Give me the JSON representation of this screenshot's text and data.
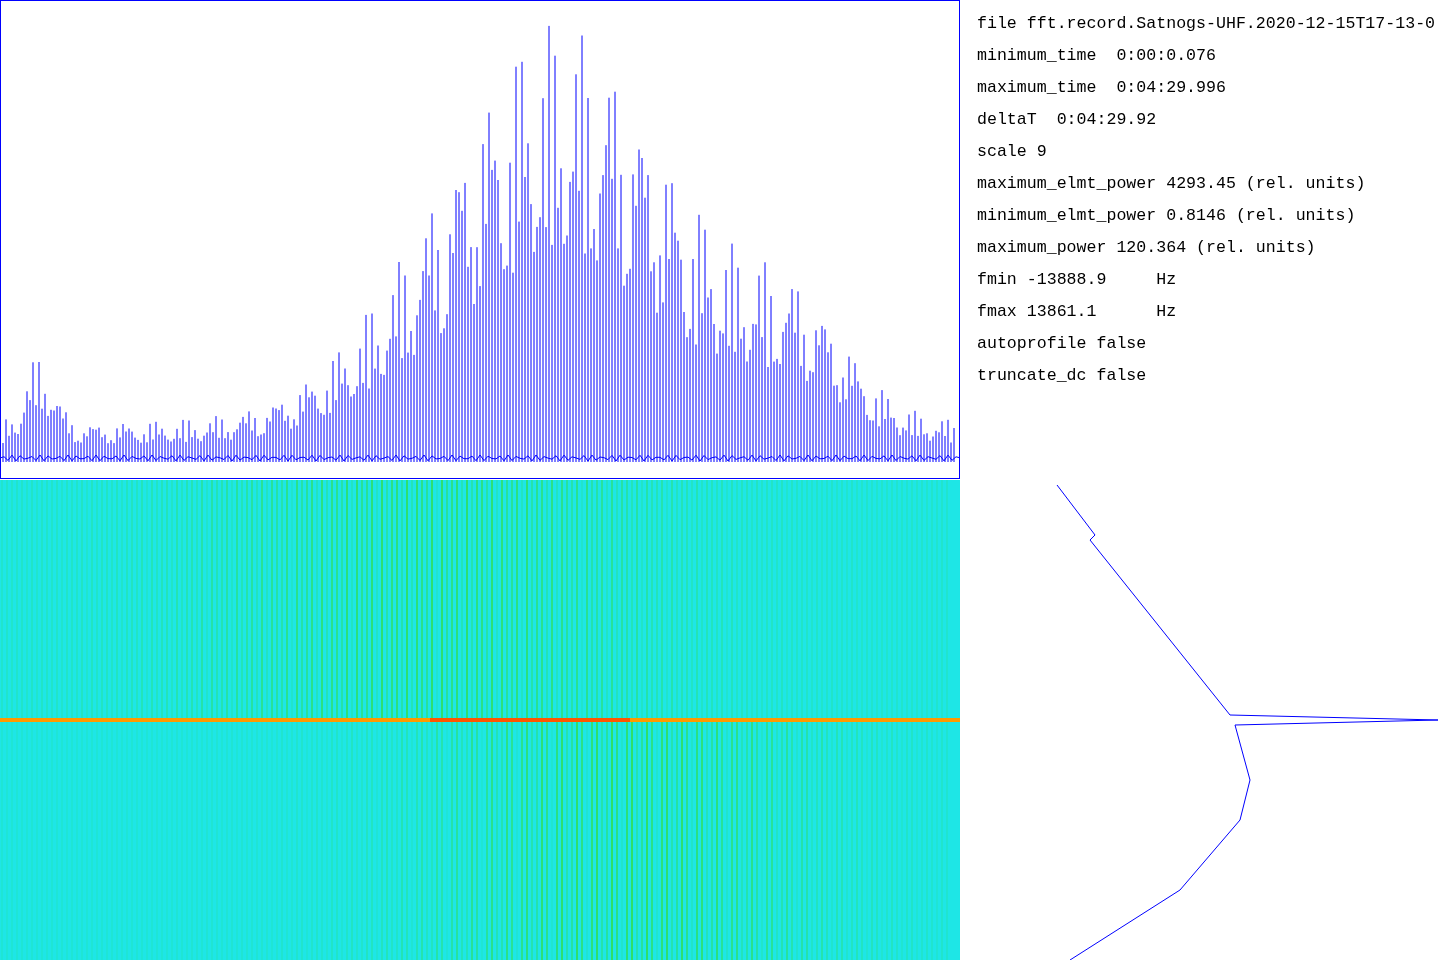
{
  "parameters": [
    "file fft.record.Satnogs-UHF.2020-12-15T17-13-0",
    "minimum_time  0:00:0.076",
    "maximum_time  0:04:29.996",
    "deltaT  0:04:29.92",
    "scale 9",
    "maximum_elmt_power 4293.45 (rel. units)",
    "minimum_elmt_power 0.8146 (rel. units)",
    "maximum_power 120.364 (rel. units)",
    "fmin -13888.9     Hz",
    "fmax 13861.1      Hz",
    "autoprofile false",
    "truncate_dc false"
  ]
}
